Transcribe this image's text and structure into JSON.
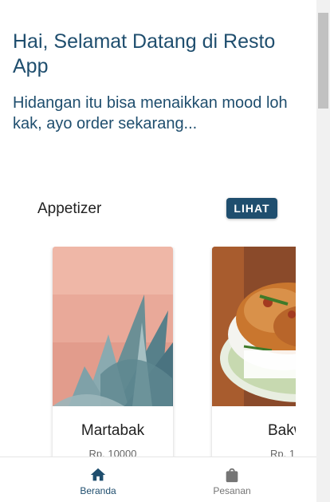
{
  "header": {
    "title": "Hai, Selamat Datang di Resto App",
    "subtitle": "Hidangan itu bisa menaikkan mood loh kak, ayo order sekarang..."
  },
  "section": {
    "title": "Appetizer",
    "button_label": "LIHAT"
  },
  "menu_items": [
    {
      "name": "Martabak",
      "price": "Rp. 10000",
      "image": "agave-plant-photo"
    },
    {
      "name": "Bakwan",
      "price": "Rp. 1",
      "image": "fried-fritter-photo"
    }
  ],
  "bottom_nav": {
    "items": [
      {
        "label": "Beranda",
        "icon": "home-icon",
        "active": true
      },
      {
        "label": "Pesanan",
        "icon": "shopping-bag-icon",
        "active": false
      }
    ]
  },
  "colors": {
    "primary": "#1f4e6e",
    "inactive": "#757575"
  }
}
